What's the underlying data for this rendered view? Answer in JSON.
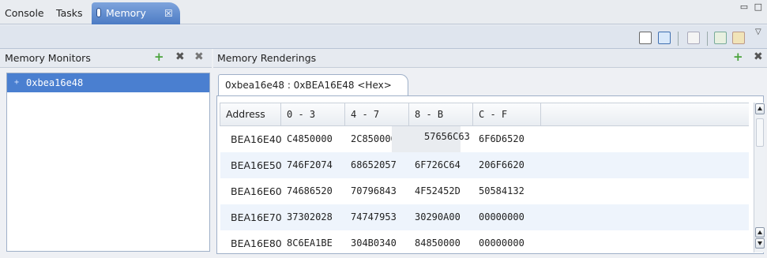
{
  "tabs": {
    "console": "Console",
    "tasks": "Tasks",
    "memory": "Memory",
    "close_glyph": "☒"
  },
  "window_buttons": "▭ □",
  "toolbar_icons": [
    "new-rendering-icon",
    "export-icon",
    "switch-memory-view-icon",
    "toggle-split-pane-icon",
    "link-memory-panes-icon"
  ],
  "view_menu_glyph": "▽",
  "monitors": {
    "title": "Memory Monitors",
    "add_glyph": "+",
    "remove_glyph": "✖",
    "remove_all_glyph": "✖",
    "items": [
      {
        "bullet": "+",
        "label": "0xbea16e48"
      }
    ]
  },
  "renderings": {
    "title": "Memory Renderings",
    "add_glyph": "+",
    "remove_glyph": "✖",
    "tab_label": "0xbea16e48 : 0xBEA16E48 <Hex>",
    "columns": [
      "Address",
      "0 - 3",
      "4 - 7",
      "8 - B",
      "C - F"
    ],
    "rows": [
      {
        "address": "BEA16E40",
        "cells": [
          "C4850000",
          "2C850000",
          "57656C63",
          "6F6D6520"
        ]
      },
      {
        "address": "BEA16E50",
        "cells": [
          "746F2074",
          "68652057",
          "6F726C64",
          "206F6620"
        ]
      },
      {
        "address": "BEA16E60",
        "cells": [
          "74686520",
          "70796843",
          "4F52452D",
          "50584132"
        ]
      },
      {
        "address": "BEA16E70",
        "cells": [
          "37302028",
          "74747953",
          "30290A00",
          "00000000"
        ]
      },
      {
        "address": "BEA16E80",
        "cells": [
          "8C6EA1BE",
          "304B0340",
          "84850000",
          "00000000"
        ]
      }
    ]
  },
  "colors": {
    "active_tab": "#4c7bc4",
    "selection": "#4a7fd0",
    "alt_row": "#eef4fc"
  }
}
